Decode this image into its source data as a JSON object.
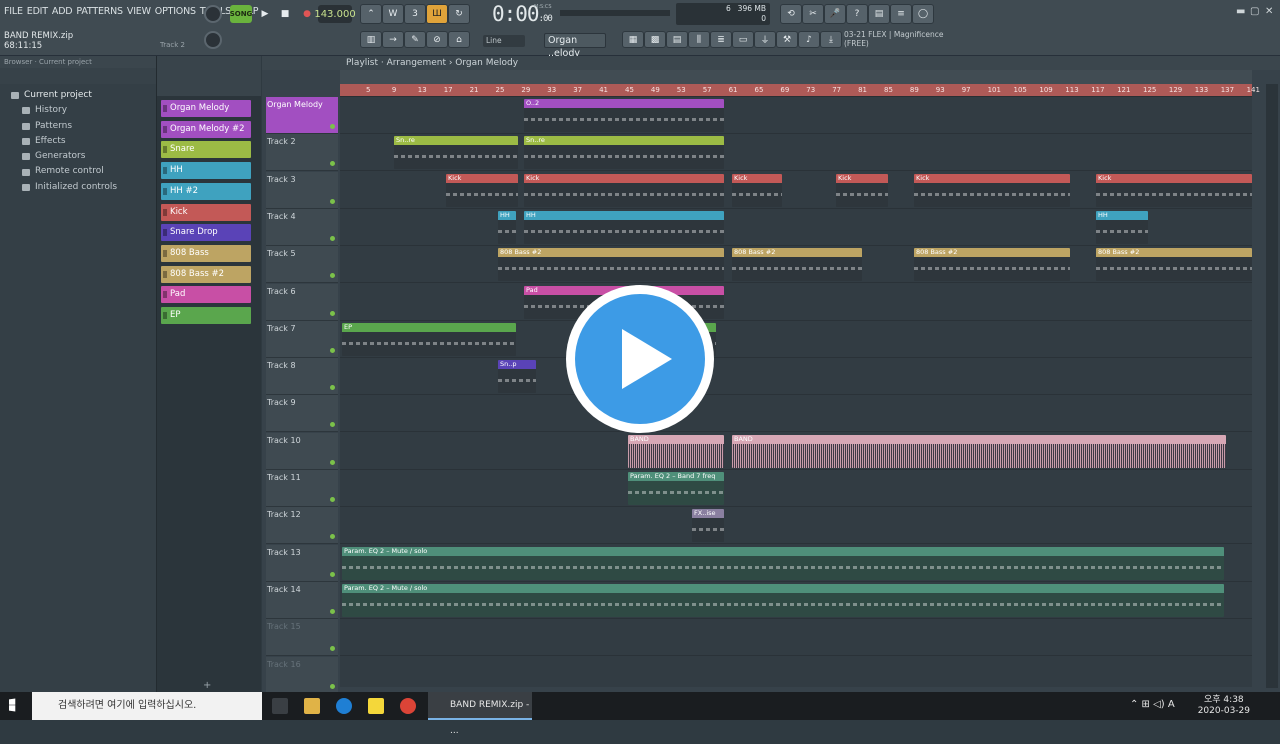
{
  "menu": [
    "FILE",
    "EDIT",
    "ADD",
    "PATTERNS",
    "VIEW",
    "OPTIONS",
    "TOOLS",
    "HELP"
  ],
  "project": {
    "file": "BAND REMIX.zip",
    "time": "68:11:15",
    "hint_track": "Track 2"
  },
  "transport": {
    "mode": "SONG",
    "tempo": "143.000",
    "clock": "0:00",
    "clock_small": ":00",
    "clock_label": "M:S:CS"
  },
  "cpu": {
    "cpu": "6",
    "mem": "396 MB",
    "poly": "0"
  },
  "pattern": {
    "name": "Organ ..elody",
    "snap": "Line"
  },
  "hint": {
    "line1": "03-21  FLEX | Magnificence",
    "line2": "(FREE)"
  },
  "browser": {
    "header": "Browser · Current project",
    "items": [
      "Current project",
      "History",
      "Patterns",
      "Effects",
      "Generators",
      "Remote control",
      "Initialized controls"
    ]
  },
  "channels": [
    {
      "name": "Organ Melody",
      "color": "#a24fc1"
    },
    {
      "name": "Organ Melody #2",
      "color": "#a24fc1"
    },
    {
      "name": "Snare",
      "color": "#9cbb45"
    },
    {
      "name": "HH",
      "color": "#3fa2bf"
    },
    {
      "name": "HH #2",
      "color": "#3fa2bf"
    },
    {
      "name": "Kick",
      "color": "#c35957"
    },
    {
      "name": "Snare Drop",
      "color": "#5a43b7"
    },
    {
      "name": "808 Bass",
      "color": "#bda463"
    },
    {
      "name": "808 Bass #2",
      "color": "#bda463"
    },
    {
      "name": "Pad",
      "color": "#c84fa5"
    },
    {
      "name": "EP",
      "color": "#5aa64d"
    }
  ],
  "playlist": {
    "breadcrumb": "Playlist · Arrangement › Organ Melody"
  },
  "ruler": [
    "5",
    "9",
    "13",
    "17",
    "21",
    "25",
    "29",
    "33",
    "37",
    "41",
    "45",
    "49",
    "53",
    "57",
    "61",
    "65",
    "69",
    "73",
    "77",
    "81",
    "85",
    "89",
    "93",
    "97",
    "101",
    "105",
    "109",
    "113",
    "117",
    "121",
    "125",
    "129",
    "133",
    "137",
    "141"
  ],
  "tracks": [
    "Organ Melody",
    "Track 2",
    "Track 3",
    "Track 4",
    "Track 5",
    "Track 6",
    "Track 7",
    "Track 8",
    "Track 9",
    "Track 10",
    "Track 11",
    "Track 12",
    "Track 13",
    "Track 14",
    "Track 15",
    "Track 16"
  ],
  "clips": {
    "organ": "O..2",
    "snare": "Sn..re",
    "kick": "Kick",
    "hh": "HH",
    "bass": "808 Bass #2",
    "pad": "Pad",
    "ep": "EP",
    "snd": "Sn..p",
    "band": "BAND",
    "param": "Param. EQ 2 – Band 7 freq",
    "fx": "FX..ise",
    "mute": "Param. EQ 2 – Mute / solo"
  },
  "taskbar": {
    "search": "검색하려면 여기에 입력하십시오.",
    "app": "BAND REMIX.zip - ...",
    "time": "오후 4:38",
    "date": "2020-03-29",
    "ime": "A"
  },
  "colors": {
    "ruler": "#ae5a57",
    "accent": "#3d9be6"
  }
}
